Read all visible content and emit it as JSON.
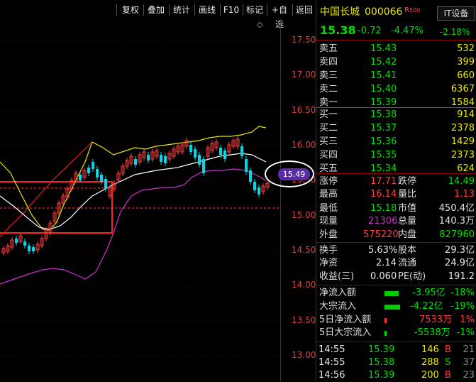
{
  "toolbar": {
    "buttons": [
      "复权",
      "叠加",
      "统计",
      "画线",
      "F10",
      "标记",
      "+自选",
      "返回"
    ]
  },
  "chart": {
    "y_ticks": [
      "17.50",
      "17.00",
      "16.50",
      "16.00",
      "15.50",
      "15.00",
      "14.50",
      "14.00",
      "13.50",
      "13.00"
    ],
    "current_price_label": "15.49",
    "diamond_icon": "◇"
  },
  "stock": {
    "name": "中国长城",
    "code": "000066",
    "tag": "R",
    "tag_num": "500",
    "sector": "IT设备",
    "sector_change": "-2.18%",
    "price": "15.38",
    "change": "-0.72",
    "change_pct": "-4.47%"
  },
  "order_book": {
    "asks": [
      {
        "label": "卖五",
        "price": "15.43",
        "vol": "532"
      },
      {
        "label": "卖四",
        "price": "15.42",
        "vol": "399"
      },
      {
        "label": "卖三",
        "price": "15.41",
        "vol": "660"
      },
      {
        "label": "卖二",
        "price": "15.40",
        "vol": "6367"
      },
      {
        "label": "卖一",
        "price": "15.39",
        "vol": "1584"
      }
    ],
    "bids": [
      {
        "label": "买一",
        "price": "15.38",
        "vol": "914"
      },
      {
        "label": "买二",
        "price": "15.37",
        "vol": "2378"
      },
      {
        "label": "买三",
        "price": "15.36",
        "vol": "1429"
      },
      {
        "label": "买四",
        "price": "15.35",
        "vol": "2373"
      },
      {
        "label": "买五",
        "price": "15.34",
        "vol": "624"
      }
    ]
  },
  "stats": {
    "limit_up_label": "涨停",
    "limit_up": "17.71",
    "limit_down_label": "跌停",
    "limit_down": "14.49",
    "high_label": "最高",
    "high": "16.14",
    "vol_ratio_label": "量比",
    "vol_ratio": "1.13",
    "low_label": "最低",
    "low": "15.18",
    "mkt_cap_label": "市值",
    "mkt_cap": "450.4亿",
    "cur_vol_label": "现量",
    "cur_vol": "21306",
    "total_vol_label": "总量",
    "total_vol": "140.3万",
    "outer_label": "外盘",
    "outer": "575220",
    "inner_label": "内盘",
    "inner": "827960",
    "turnover_label": "换手",
    "turnover": "5.63%",
    "shares_label": "股本",
    "shares": "29.3亿",
    "nav_label": "净资",
    "nav": "2.14",
    "float_label": "流通",
    "float": "24.9亿",
    "eps_label": "收益(三)",
    "eps": "0.060",
    "pe_label": "PE(动)",
    "pe": "191.2"
  },
  "flows": [
    {
      "label": "净流入额",
      "value": "-3.95亿",
      "pct": "-18%"
    },
    {
      "label": "大宗流入",
      "value": "-4.22亿",
      "pct": "-19%"
    },
    {
      "label": "5日净流入额",
      "value": "7533万",
      "pct": "1%"
    },
    {
      "label": "5日大宗流入",
      "value": "-5538万",
      "pct": "-1%"
    }
  ],
  "ticks": [
    {
      "time": "14:55",
      "price": "15.39",
      "vol": "146",
      "side": "B",
      "count": "21"
    },
    {
      "time": "14:55",
      "price": "15.38",
      "vol": "288",
      "side": "S",
      "count": "37"
    },
    {
      "time": "14:56",
      "price": "15.39",
      "vol": "200",
      "side": "B",
      "count": "23"
    }
  ],
  "colors": {
    "up": "#ff4040",
    "down": "#00dd00",
    "ma_yellow": "#e8e800",
    "ma_white": "#ffffff",
    "ma_magenta": "#cc33cc",
    "box_red": "#ff2020",
    "axis_red": "#b00000"
  }
}
